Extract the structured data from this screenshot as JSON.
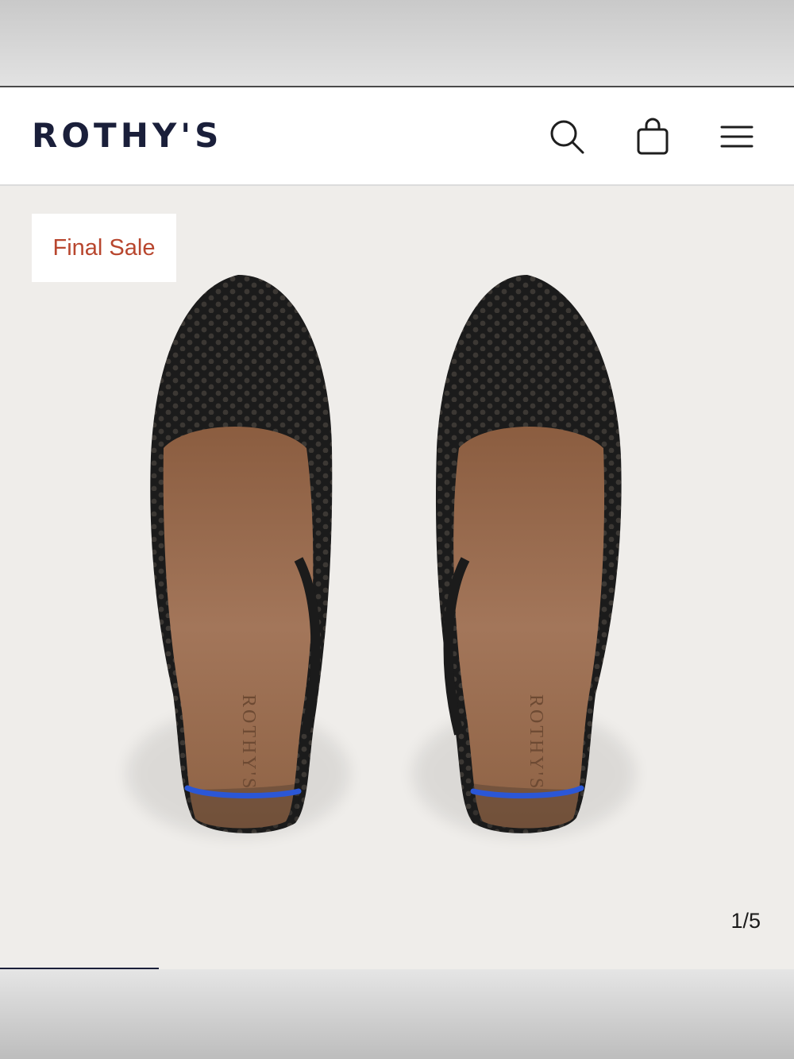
{
  "header": {
    "logo": "ROTHY'S",
    "icons": [
      "search-icon",
      "shopping-bag-icon",
      "menu-icon"
    ]
  },
  "product_gallery": {
    "badge": "Final Sale",
    "counter": "1/5",
    "current_image": 1,
    "total_images": 5,
    "insole_brand": "ROTHY'S"
  },
  "colors": {
    "logo": "#1a1f3a",
    "badge_text": "#b8462e",
    "stage_bg": "#efedea",
    "shoe_knit": "#1b1b1b",
    "insole": "#9a6a4a",
    "heel_accent": "#2b57d6"
  }
}
